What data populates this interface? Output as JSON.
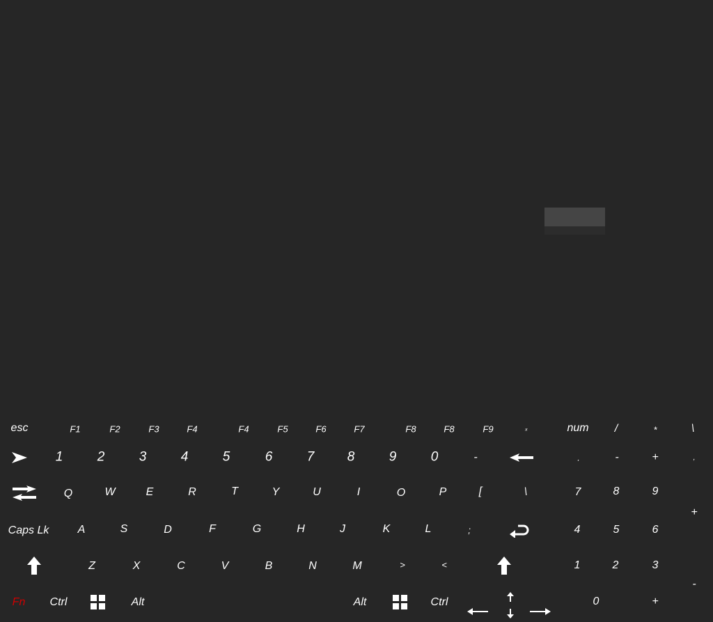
{
  "keyboard": {
    "function_row": {
      "esc": "esc",
      "f1": "F1",
      "f2": "F2",
      "f3": "F3",
      "f4": "F4",
      "f4b": "F4",
      "f5": "F5",
      "f6": "F6",
      "f7": "F7",
      "f8": "F8",
      "f8b": "F8",
      "f9": "F9",
      "small": "ₓ",
      "num": "num",
      "slash": "/",
      "asterisk": "*",
      "backslash": "\\"
    },
    "number_row": {
      "k1": "1",
      "k2": "2",
      "k3": "3",
      "k4": "4",
      "k5": "5",
      "k6": "6",
      "k7": "7",
      "k8": "8",
      "k9": "9",
      "k0": "0",
      "minus": "-",
      "np_dot": ".",
      "np_minus": "-",
      "np_plus": "+",
      "np_comma": ","
    },
    "qwerty_row": {
      "q": "Q",
      "w": "W",
      "e": "E",
      "r": "R",
      "t": "T",
      "y": "Y",
      "u": "U",
      "i": "I",
      "o": "O",
      "p": "P",
      "bracket": "[",
      "backslash": "\\",
      "np7": "7",
      "np8": "8",
      "np9": "9",
      "np_plus": "+"
    },
    "home_row": {
      "caps": "Caps Lk",
      "a": "A",
      "s": "S",
      "d": "D",
      "f": "F",
      "g": "G",
      "h": "H",
      "j": "J",
      "k": "K",
      "l": "L",
      "semicolon": ";",
      "np4": "4",
      "np5": "5",
      "np6": "6"
    },
    "shift_row": {
      "z": "Z",
      "x": "X",
      "c": "C",
      "v": "V",
      "b": "B",
      "n": "N",
      "m": "M",
      "gt": ">",
      "lt": "<",
      "np1": "1",
      "np2": "2",
      "np3": "3",
      "np_minus": "-"
    },
    "bottom_row": {
      "fn": "Fn",
      "ctrl_left": "Ctrl",
      "alt_left": "Alt",
      "alt_right": "Alt",
      "ctrl_right": "Ctrl",
      "np0": "0",
      "np_plus": "+"
    },
    "icons": {
      "play": "play-icon",
      "tab": "tab-arrows-icon",
      "backspace": "backspace-arrow-icon",
      "enter": "enter-icon",
      "shift": "shift-arrow-icon",
      "windows": "windows-icon",
      "arrows": "arrow-key-icons"
    },
    "colors": {
      "background": "#262626",
      "key_text": "#ffffff",
      "fn_text": "#d00000",
      "overlay": "#454545"
    }
  }
}
